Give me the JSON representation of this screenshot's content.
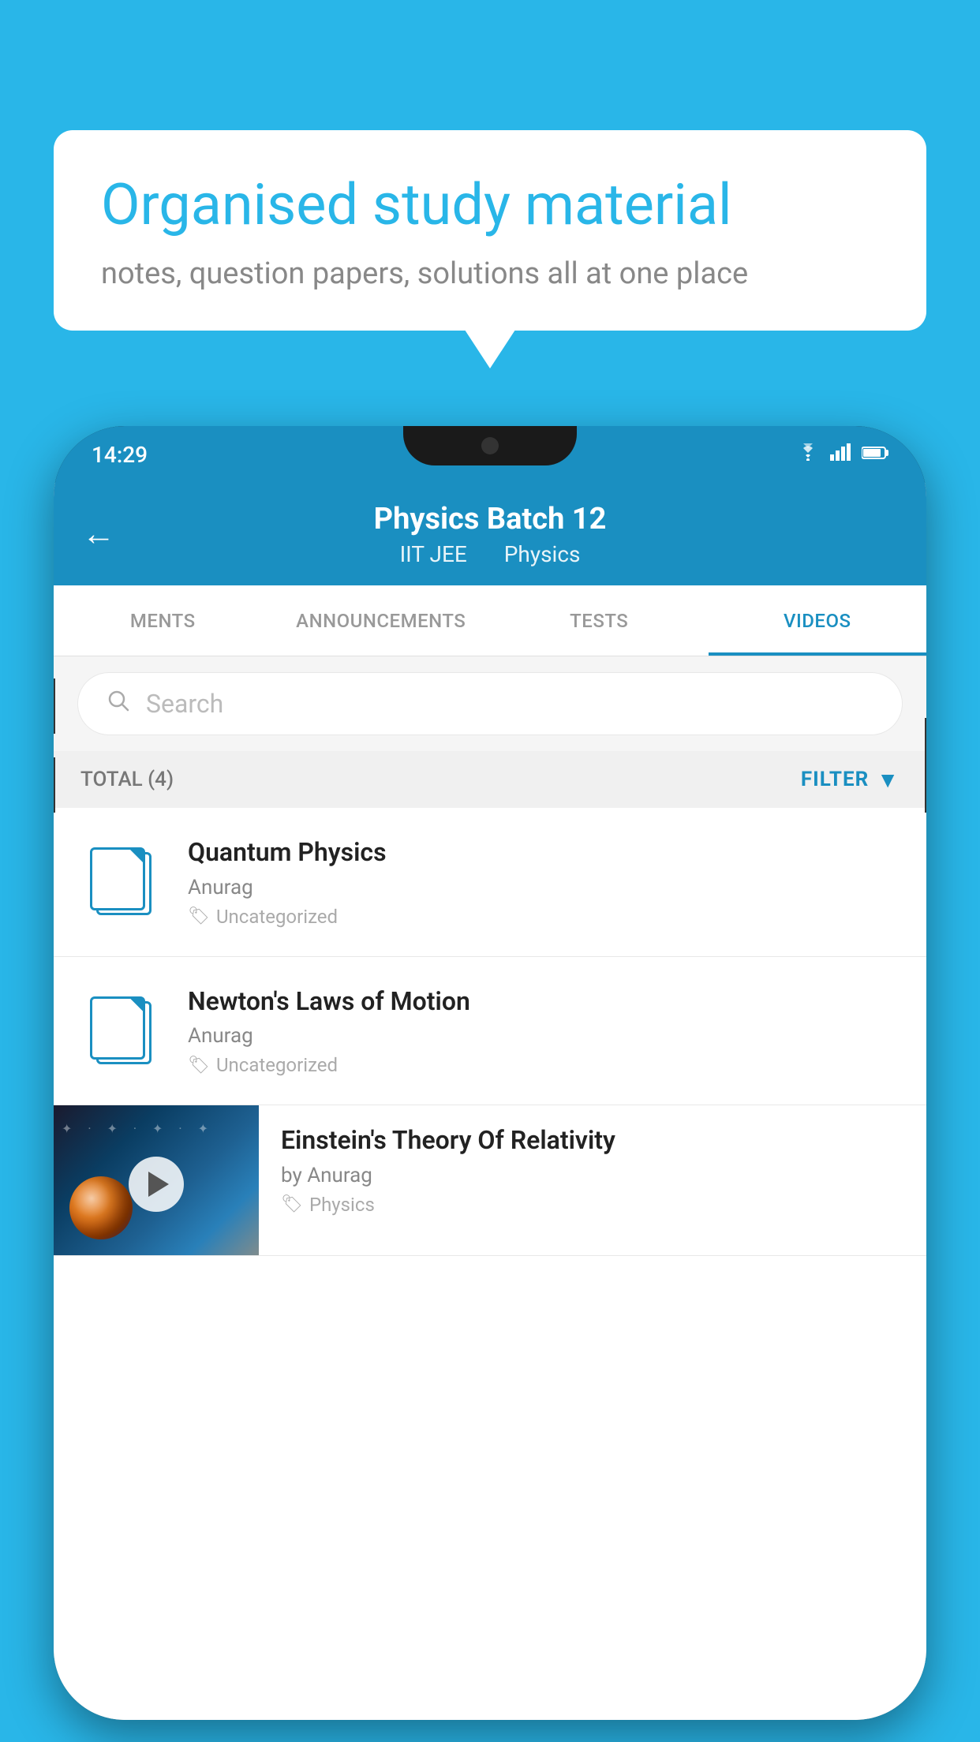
{
  "page": {
    "background_color": "#29b6e8"
  },
  "speech_bubble": {
    "title": "Organised study material",
    "subtitle": "notes, question papers, solutions all at one place"
  },
  "phone": {
    "status_bar": {
      "time": "14:29",
      "icons": [
        "wifi",
        "signal",
        "battery"
      ]
    },
    "header": {
      "back_label": "←",
      "title": "Physics Batch 12",
      "subtitle_part1": "IIT JEE",
      "subtitle_part2": "Physics"
    },
    "tabs": [
      {
        "label": "MENTS",
        "active": false
      },
      {
        "label": "ANNOUNCEMENTS",
        "active": false
      },
      {
        "label": "TESTS",
        "active": false
      },
      {
        "label": "VIDEOS",
        "active": true
      }
    ],
    "search": {
      "placeholder": "Search"
    },
    "filter_bar": {
      "total_label": "TOTAL (4)",
      "filter_label": "FILTER"
    },
    "video_items": [
      {
        "id": "quantum",
        "title": "Quantum Physics",
        "author": "Anurag",
        "tag": "Uncategorized",
        "type": "file"
      },
      {
        "id": "newton",
        "title": "Newton's Laws of Motion",
        "author": "Anurag",
        "tag": "Uncategorized",
        "type": "file"
      },
      {
        "id": "einstein",
        "title": "Einstein's Theory Of Relativity",
        "author": "by Anurag",
        "tag": "Physics",
        "type": "video"
      }
    ]
  }
}
